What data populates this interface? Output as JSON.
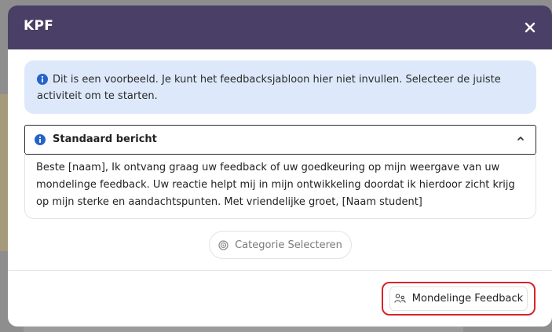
{
  "modal": {
    "title": "KPF",
    "close_icon": "close-icon"
  },
  "info_alert": {
    "icon": "info-circle-icon",
    "text": "Dit is een voorbeeld. Je kunt het feedbacksjabloon hier niet invullen. Selecteer de juiste activiteit om te starten."
  },
  "accordion": {
    "icon": "info-circle-icon",
    "title": "Standaard bericht",
    "expanded": true,
    "chevron_icon": "chevron-up-icon",
    "body": "Beste [naam], Ik ontvang graag uw feedback of uw goedkeuring op mijn weergave van uw mondelinge feedback. Uw reactie helpt mij in mijn ontwikkeling doordat ik hierdoor zicht krijg op mijn sterke en aandachtspunten. Met vriendelijke groet, [Naam student]"
  },
  "category_button": {
    "icon": "target-icon",
    "label": "Categorie Selecteren"
  },
  "footer": {
    "primary_button": {
      "icon": "users-speech-icon",
      "label": "Mondelinge Feedback"
    }
  },
  "colors": {
    "header_bg": "#4a3f66",
    "alert_bg": "#dde9fb",
    "info_icon": "#2563c9",
    "highlight_border": "#d8232a"
  }
}
